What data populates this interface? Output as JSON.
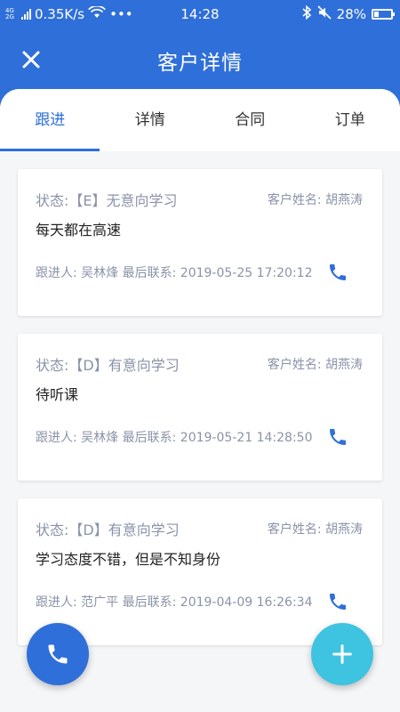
{
  "status_bar": {
    "network": "4G 2G",
    "speed": "0.35K/s",
    "dots": "•••",
    "time": "14:28",
    "battery": "28%",
    "battery_level": 0.28
  },
  "header": {
    "title": "客户详情"
  },
  "tabs": [
    {
      "label": "跟进"
    },
    {
      "label": "详情"
    },
    {
      "label": "合同"
    },
    {
      "label": "订单"
    }
  ],
  "records": [
    {
      "status": "状态:【E】无意向学习",
      "customer": "客户姓名: 胡燕涛",
      "note": "每天都在高速",
      "follow": "跟进人: 吴林烽 最后联系: 2019-05-25 17:20:12"
    },
    {
      "status": "状态:【D】有意向学习",
      "customer": "客户姓名: 胡燕涛",
      "note": "待听课",
      "follow": "跟进人: 吴林烽 最后联系: 2019-05-21 14:28:50"
    },
    {
      "status": "状态:【D】有意向学习",
      "customer": "客户姓名: 胡燕涛",
      "note": "学习态度不错，但是不知身份",
      "follow": "跟进人: 范广平 最后联系: 2019-04-09 16:26:34"
    }
  ],
  "colors": {
    "primary": "#2f6fd9",
    "accent": "#3ec3e0",
    "muted_text": "#8a93a8"
  }
}
